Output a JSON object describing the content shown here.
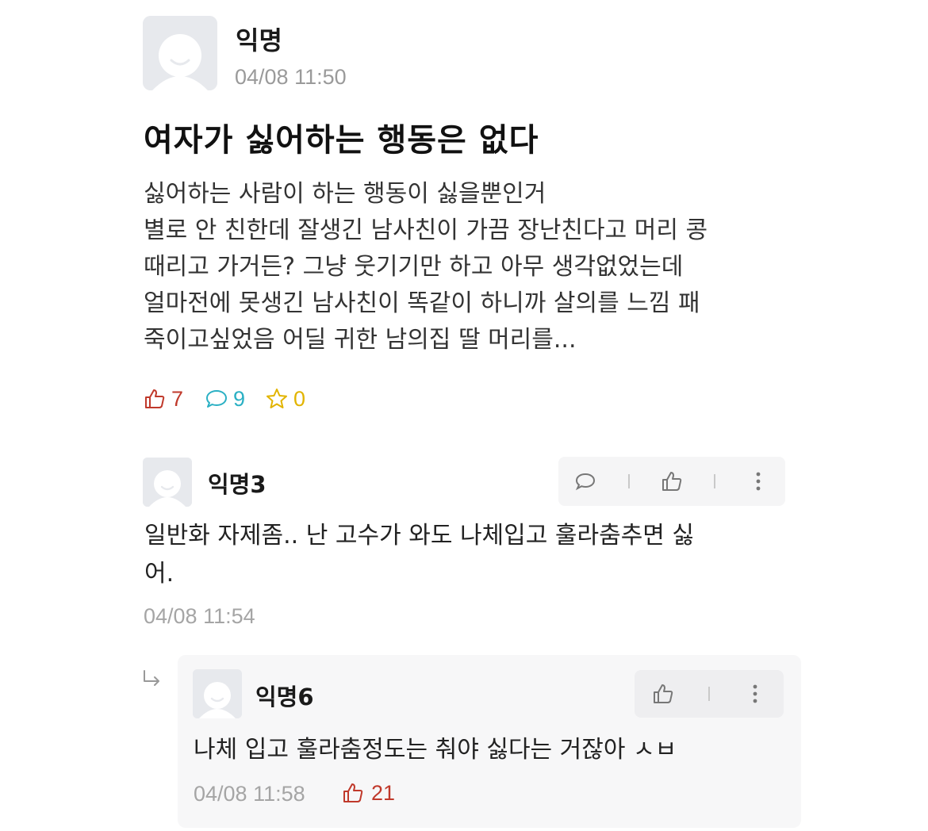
{
  "post": {
    "author": "익명",
    "time": "04/08 11:50",
    "title": "여자가 싫어하는 행동은 없다",
    "body_lines": [
      "싫어하는 사람이 하는 행동이 싫을뿐인거",
      "별로 안 친한데 잘생긴 남사친이 가끔 장난친다고 머리 콩",
      "때리고 가거든? 그냥 웃기기만 하고 아무 생각없었는데",
      "얼마전에 못생긴 남사친이 똑같이 하니까 살의를 느낌  패",
      "죽이고싶었음 어딜 귀한 남의집 딸 머리를..."
    ],
    "stats": {
      "likes": "7",
      "comments": "9",
      "scraps": "0"
    }
  },
  "comment": {
    "author": "익명3",
    "text_lines": [
      "일반화 자제좀.. 난 고수가 와도 나체입고 훌라춤추면 싫",
      "어."
    ],
    "time": "04/08 11:54"
  },
  "reply": {
    "author": "익명6",
    "text": "나체 입고 훌라춤정도는 춰야 싫다는 거잖아 ㅅㅂ",
    "time": "04/08 11:58",
    "likes": "21"
  },
  "colors": {
    "like": "#c0392b",
    "comment": "#2bb0c4",
    "scrap": "#e2b400",
    "meta_gray": "#a5a5a5"
  }
}
